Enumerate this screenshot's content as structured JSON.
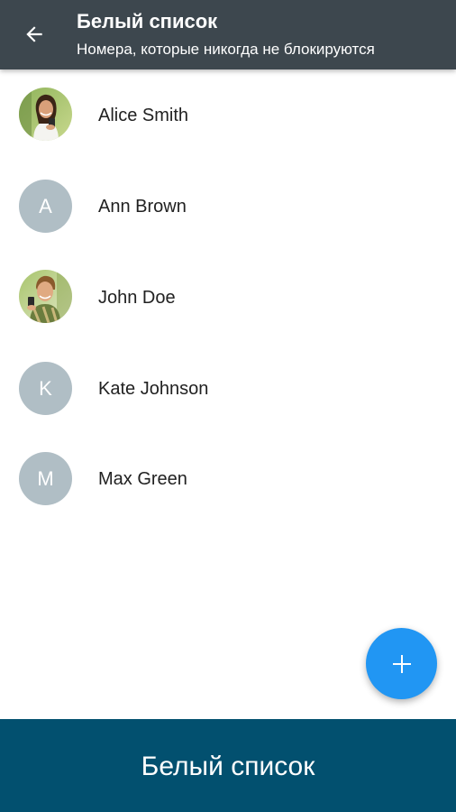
{
  "colors": {
    "toolbar_bg": "#3d474e",
    "fab_bg": "#2196f3",
    "footer_bg": "#02506f",
    "avatar_placeholder": "#b0bec5"
  },
  "toolbar": {
    "back_icon": "arrow-back-icon",
    "title": "Белый список",
    "subtitle": "Номера, которые никогда не блокируются"
  },
  "contacts": [
    {
      "name": "Alice Smith",
      "avatar": "photo",
      "initial": ""
    },
    {
      "name": "Ann Brown",
      "avatar": "letter",
      "initial": "A"
    },
    {
      "name": "John Doe",
      "avatar": "photo",
      "initial": ""
    },
    {
      "name": "Kate Johnson",
      "avatar": "letter",
      "initial": "K"
    },
    {
      "name": "Max Green",
      "avatar": "letter",
      "initial": "M"
    }
  ],
  "fab": {
    "icon": "plus-icon"
  },
  "footer": {
    "label": "Белый список"
  }
}
